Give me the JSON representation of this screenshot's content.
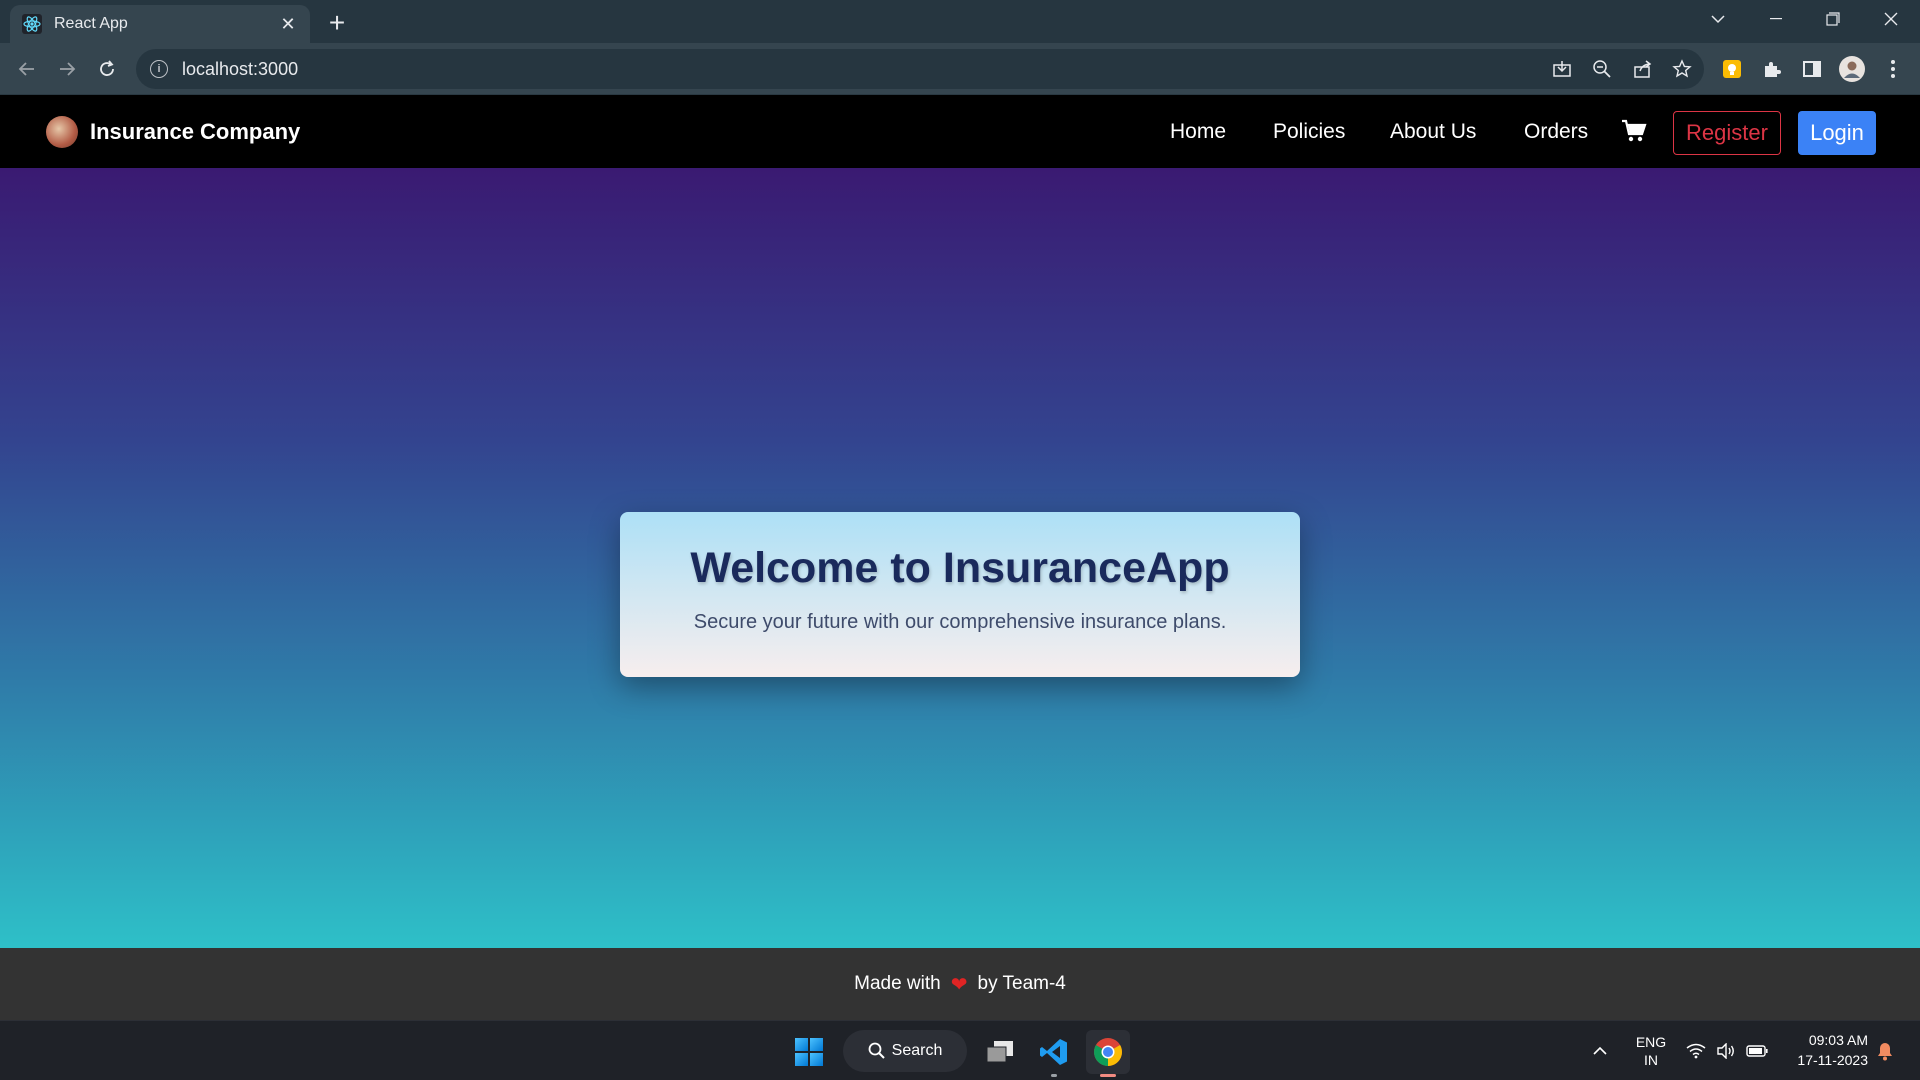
{
  "browser": {
    "tab_title": "React App",
    "url": "localhost:3000"
  },
  "navbar": {
    "brand": "Insurance Company",
    "links": [
      "Home",
      "Policies",
      "About Us",
      "Orders"
    ],
    "register": "Register",
    "login": "Login"
  },
  "hero": {
    "title": "Welcome to InsuranceApp",
    "subtitle": "Secure your future with our comprehensive insurance plans."
  },
  "footer": {
    "prefix": "Made with",
    "heart": "❤",
    "suffix": "by Team-4"
  },
  "taskbar": {
    "search": "Search",
    "lang": "ENG",
    "region": "IN",
    "time": "09:03 AM",
    "date": "17-11-2023"
  },
  "colors": {
    "register": "#dc3545",
    "login": "#3b82f6",
    "hero_top": "#3a1a72",
    "hero_bottom": "#2ec0c8"
  }
}
